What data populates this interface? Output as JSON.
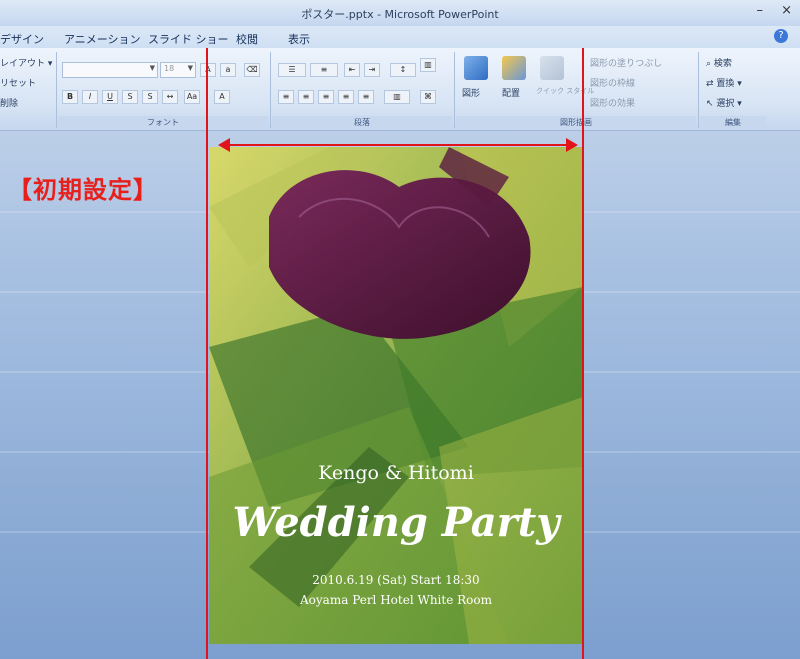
{
  "window": {
    "title": "ポスター.pptx - Microsoft PowerPoint",
    "minimize": "–",
    "close": "×"
  },
  "tabs": [
    {
      "label": "デザイン"
    },
    {
      "label": "アニメーション"
    },
    {
      "label": "スライド ショー"
    },
    {
      "label": "校閲"
    },
    {
      "label": "表示"
    }
  ],
  "ribbon": {
    "slides_group": {
      "layout": "レイアウト ▾",
      "reset": "リセット",
      "delete": "削除"
    },
    "font_group": {
      "label": "フォント",
      "font_size_placeholder": "18"
    },
    "paragraph_group": {
      "label": "段落"
    },
    "drawing_group": {
      "shape": "図形",
      "arrange": "配置",
      "quick_style": "クイック スタイル",
      "fill": "図形の塗りつぶし",
      "outline": "図形の枠線",
      "effects": "図形の効果",
      "label": "図形描画"
    },
    "edit_group": {
      "find": "検索",
      "replace": "置換 ▾",
      "select": "選択 ▾",
      "label": "編集"
    }
  },
  "annotation": {
    "label": "【初期設定】",
    "color": "#e0141a"
  },
  "slide": {
    "names": "Kengo & Hitomi",
    "title": "Wedding Party",
    "date_line": "2010.6.19 (Sat)   Start   18:30",
    "venue_line": "Aoyama Perl Hotel  White Room"
  }
}
